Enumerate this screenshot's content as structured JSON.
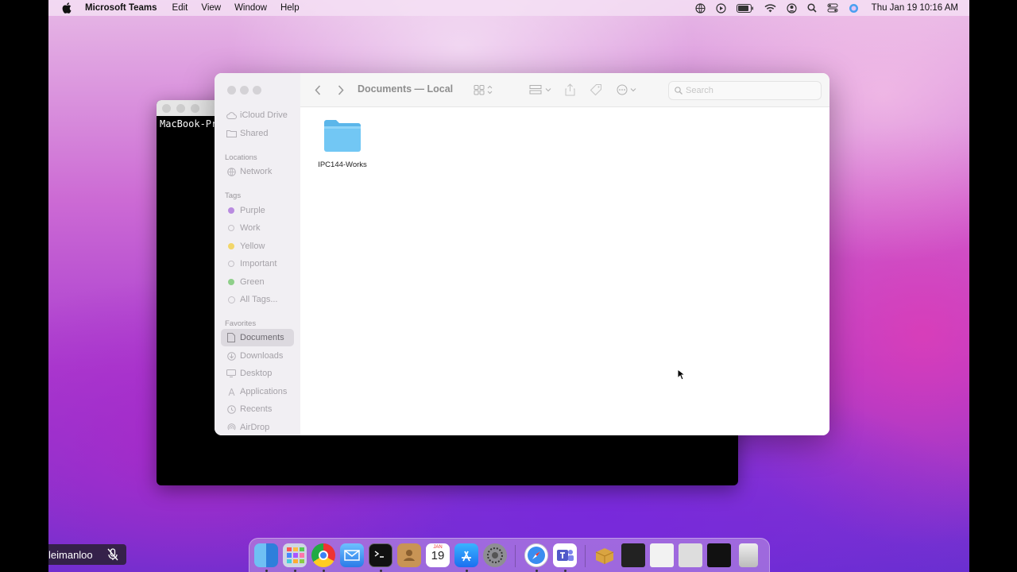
{
  "menubar": {
    "app_name": "Microsoft Teams",
    "menus": [
      "Edit",
      "View",
      "Window",
      "Help"
    ],
    "clock": "Thu Jan 19  10:16 AM"
  },
  "terminal": {
    "prompt_text": "MacBook-Pr"
  },
  "finder": {
    "title": "Documents — Local",
    "search_placeholder": "Search",
    "sidebar": {
      "icloud": [
        {
          "label": "iCloud Drive",
          "icon": "cloud-icon"
        },
        {
          "label": "Shared",
          "icon": "shared-folder-icon"
        }
      ],
      "locations_header": "Locations",
      "locations": [
        {
          "label": "Network",
          "icon": "globe-icon"
        }
      ],
      "tags_header": "Tags",
      "tags": [
        {
          "label": "Purple",
          "color": "#b98be0"
        },
        {
          "label": "Work",
          "color": ""
        },
        {
          "label": "Yellow",
          "color": "#f2d66a"
        },
        {
          "label": "Important",
          "color": ""
        },
        {
          "label": "Green",
          "color": "#8fcf8a"
        },
        {
          "label": "All Tags...",
          "color": ""
        }
      ],
      "favorites_header": "Favorites",
      "favorites": [
        {
          "label": "Documents",
          "icon": "document-icon",
          "selected": true
        },
        {
          "label": "Downloads",
          "icon": "download-icon"
        },
        {
          "label": "Desktop",
          "icon": "desktop-icon"
        },
        {
          "label": "Applications",
          "icon": "applications-icon"
        },
        {
          "label": "Recents",
          "icon": "clock-icon"
        },
        {
          "label": "AirDrop",
          "icon": "airdrop-icon"
        }
      ]
    },
    "items": [
      {
        "name": "IPC144-Works",
        "type": "folder"
      }
    ]
  },
  "dock": {
    "calendar_month": "JAN",
    "calendar_day": "19"
  },
  "participant": {
    "name": "leimanloo"
  },
  "colors": {
    "folder_blue": "#6cc3f2",
    "selection_gray": "#dcd9df"
  }
}
